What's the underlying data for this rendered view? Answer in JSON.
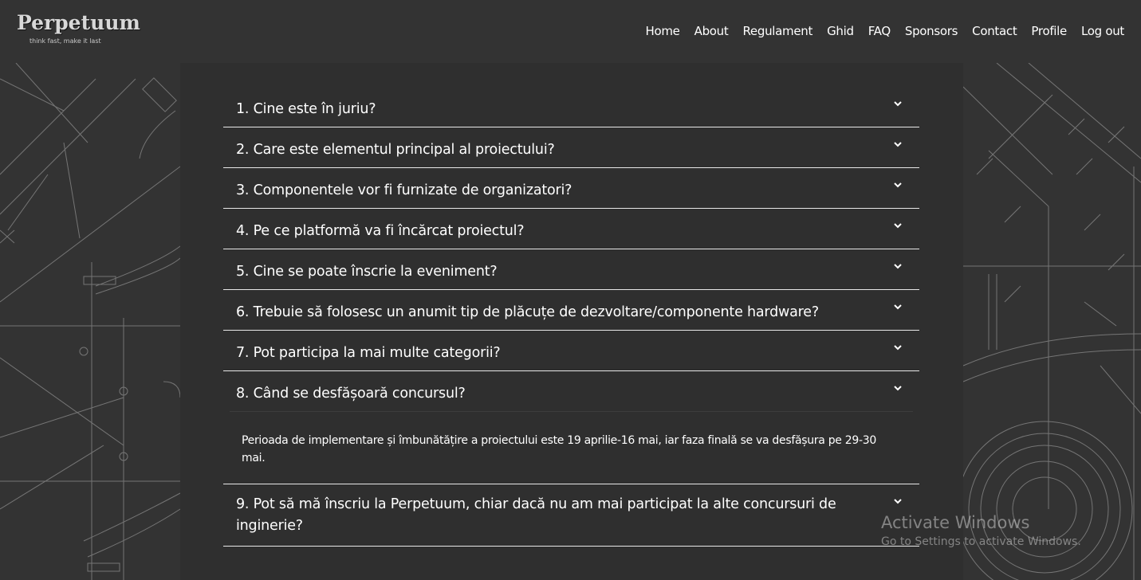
{
  "brand": {
    "name": "Perpetuum",
    "tagline": "think fast, make it last"
  },
  "nav": {
    "items": [
      {
        "label": "Home"
      },
      {
        "label": "About"
      },
      {
        "label": "Regulament"
      },
      {
        "label": "Ghid"
      },
      {
        "label": "FAQ"
      },
      {
        "label": "Sponsors"
      },
      {
        "label": "Contact"
      },
      {
        "label": "Profile"
      },
      {
        "label": "Log out"
      }
    ]
  },
  "faq": {
    "items": [
      {
        "question": "1. Cine este în juriu?"
      },
      {
        "question": "2. Care este elementul principal al proiectului?"
      },
      {
        "question": "3. Componentele vor fi furnizate de organizatori?"
      },
      {
        "question": "4. Pe ce platformă va fi încărcat proiectul?"
      },
      {
        "question": "5. Cine se poate înscrie la eveniment?"
      },
      {
        "question": "6. Trebuie să folosesc un anumit tip de plăcuțe de dezvoltare/componente hardware?"
      },
      {
        "question": "7. Pot participa la mai multe categorii?"
      },
      {
        "question": "8. Când se desfășoară concursul?",
        "answer": "Perioada de implementare și îmbunătățire a proiectului este 19 aprilie-16 mai, iar faza finală se va desfășura pe 29-30 mai.",
        "expanded": true
      },
      {
        "question": "9. Pot să mă înscriu la Perpetuum, chiar dacă nu am mai participat la alte concursuri de inginerie?"
      }
    ]
  },
  "watermark": {
    "title": "Activate Windows",
    "subtitle": "Go to Settings to activate Windows."
  },
  "colors": {
    "header_bg": "#333333",
    "panel_bg": "#2f2f2f",
    "text": "#ffffff",
    "divider": "#e8e8e8"
  },
  "icons": {
    "faq_toggle": "chevron-down-icon"
  }
}
